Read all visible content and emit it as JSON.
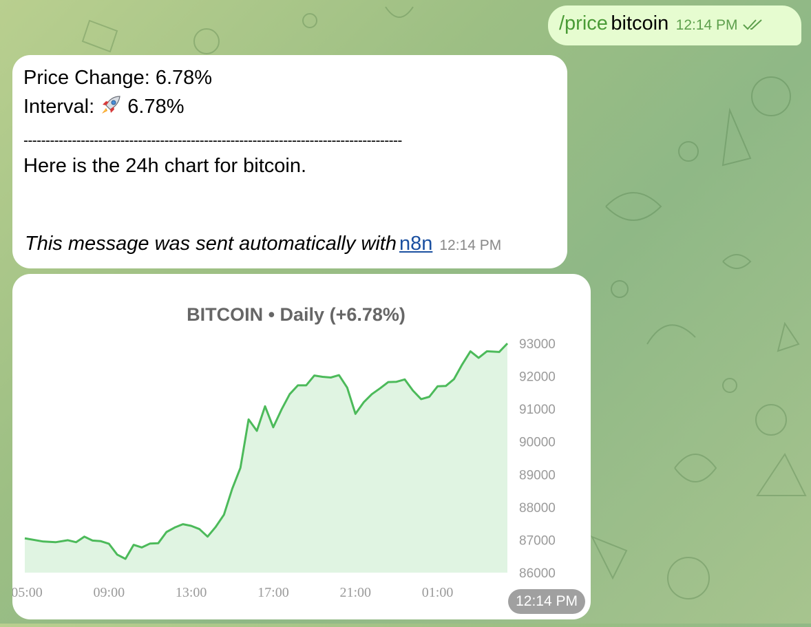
{
  "outgoing": {
    "command": "/price",
    "argument": "bitcoin",
    "time": "12:14 PM"
  },
  "incoming": {
    "price_change": "Price Change: 6.78%",
    "interval_prefix": "Interval:",
    "interval_icon": "rocket-icon",
    "interval_value": "6.78%",
    "separator": "--------------------------------------------------------------------------------------",
    "chart_line": "Here is the 24h chart for bitcoin.",
    "footer_text": "This message was sent automatically with",
    "footer_link": "n8n",
    "time": "12:14 PM"
  },
  "chart_message": {
    "time": "12:14 PM"
  },
  "chart_data": {
    "type": "area",
    "title": "BITCOIN • Daily (+6.78%)",
    "x_ticks": [
      "05:00",
      "09:00",
      "13:00",
      "17:00",
      "21:00",
      "01:00"
    ],
    "y_ticks": [
      86000,
      87000,
      88000,
      89000,
      90000,
      91000,
      92000,
      93000
    ],
    "ylim": [
      86000,
      93000
    ],
    "x_range_hours": [
      4.9,
      28.4
    ],
    "line_color": "#4cba5a",
    "fill_color": "#e0f4e2",
    "points": [
      [
        4.9,
        87050
      ],
      [
        5.8,
        86950
      ],
      [
        6.4,
        86930
      ],
      [
        7.0,
        86990
      ],
      [
        7.4,
        86930
      ],
      [
        7.8,
        87100
      ],
      [
        8.2,
        86980
      ],
      [
        8.6,
        86960
      ],
      [
        9.0,
        86880
      ],
      [
        9.4,
        86550
      ],
      [
        9.8,
        86420
      ],
      [
        10.2,
        86850
      ],
      [
        10.6,
        86770
      ],
      [
        11.0,
        86890
      ],
      [
        11.4,
        86900
      ],
      [
        11.8,
        87240
      ],
      [
        12.2,
        87380
      ],
      [
        12.6,
        87480
      ],
      [
        13.0,
        87430
      ],
      [
        13.4,
        87330
      ],
      [
        13.8,
        87100
      ],
      [
        14.2,
        87400
      ],
      [
        14.6,
        87770
      ],
      [
        15.0,
        88560
      ],
      [
        15.4,
        89200
      ],
      [
        15.8,
        90680
      ],
      [
        16.2,
        90330
      ],
      [
        16.6,
        91080
      ],
      [
        17.0,
        90440
      ],
      [
        17.4,
        90980
      ],
      [
        17.8,
        91450
      ],
      [
        18.2,
        91720
      ],
      [
        18.6,
        91720
      ],
      [
        19.0,
        92020
      ],
      [
        19.4,
        91980
      ],
      [
        19.8,
        91960
      ],
      [
        20.2,
        92030
      ],
      [
        20.6,
        91650
      ],
      [
        21.0,
        90850
      ],
      [
        21.4,
        91200
      ],
      [
        21.8,
        91450
      ],
      [
        22.2,
        91630
      ],
      [
        22.6,
        91820
      ],
      [
        23.0,
        91830
      ],
      [
        23.4,
        91900
      ],
      [
        23.8,
        91560
      ],
      [
        24.2,
        91300
      ],
      [
        24.6,
        91370
      ],
      [
        25.0,
        91690
      ],
      [
        25.4,
        91700
      ],
      [
        25.8,
        91910
      ],
      [
        26.2,
        92360
      ],
      [
        26.6,
        92760
      ],
      [
        27.0,
        92560
      ],
      [
        27.4,
        92760
      ],
      [
        28.0,
        92740
      ],
      [
        28.4,
        93000
      ]
    ]
  }
}
